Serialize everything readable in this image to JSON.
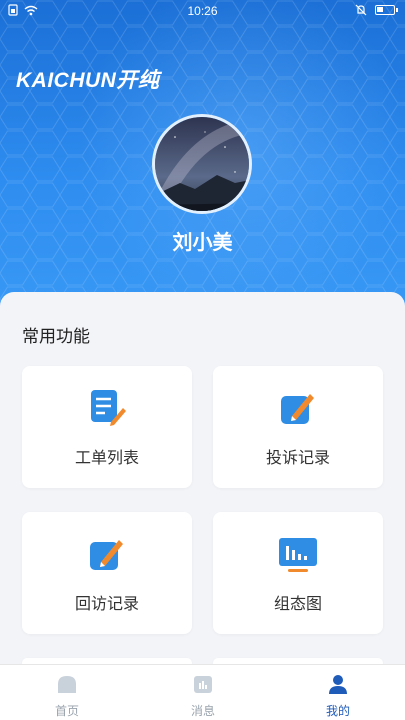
{
  "status_bar": {
    "time": "10:26"
  },
  "header": {
    "logo_text": "KAICHUN开纯",
    "user_name": "刘小美"
  },
  "section": {
    "title": "常用功能"
  },
  "cards": [
    {
      "label": "工单列表",
      "icon": "work-order-list-icon"
    },
    {
      "label": "投诉记录",
      "icon": "complaint-record-icon"
    },
    {
      "label": "回访记录",
      "icon": "return-visit-icon"
    },
    {
      "label": "组态图",
      "icon": "configuration-chart-icon"
    }
  ],
  "bottom_nav": [
    {
      "label": "首页",
      "icon": "home-icon",
      "active": false
    },
    {
      "label": "消息",
      "icon": "message-icon",
      "active": false
    },
    {
      "label": "我的",
      "icon": "profile-icon",
      "active": true
    }
  ],
  "colors": {
    "primary": "#2e8df0",
    "icon_blue": "#2f8de4",
    "pen_orange": "#f08a2c",
    "nav_active": "#1f5bb8",
    "nav_inactive": "#9aa3ad"
  }
}
